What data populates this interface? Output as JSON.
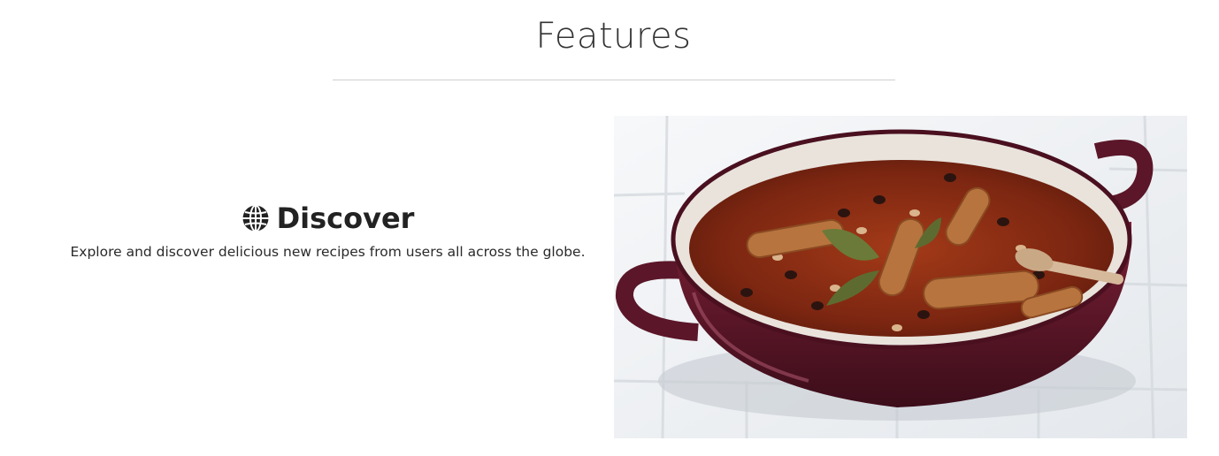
{
  "section": {
    "title": "Features"
  },
  "feature": {
    "icon": "globe-icon",
    "heading": "Discover",
    "description": "Explore and discover delicious new recipes from users all across the globe."
  },
  "colors": {
    "text": "#212529",
    "rule": "#cfcfcf",
    "pot": "#5b1629",
    "stew": "#8c2b14"
  }
}
